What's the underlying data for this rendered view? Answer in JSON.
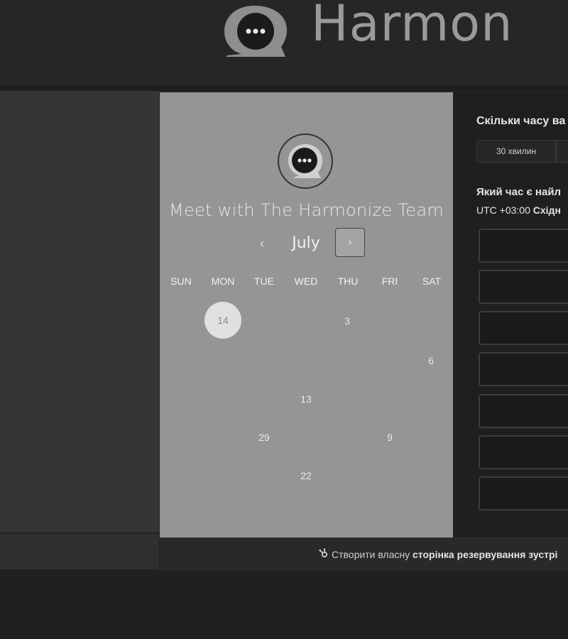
{
  "header": {
    "brand_text": "Harmon",
    "logo_icon": "chat-bubble-logo-icon"
  },
  "calendar": {
    "title": "Meet with The Harmonize Team",
    "month": "July",
    "prev_label": "‹",
    "next_label": "›",
    "weekdays": [
      "SUN",
      "MON",
      "TUE",
      "WED",
      "THU",
      "FRI",
      "SAT"
    ],
    "selected_day": "14",
    "days": [
      "3",
      "6",
      "13",
      "29",
      "9",
      "22"
    ]
  },
  "duration": {
    "question": "Скільки часу ва",
    "option_30": "30 хвилин"
  },
  "time": {
    "question": "Який час є найл",
    "timezone_prefix": "UTC +03:00",
    "timezone_name": "Східн"
  },
  "footer": {
    "text_prefix": "Створити власну",
    "text_strong": "сторінка резервування зустрі"
  },
  "colors": {
    "page_bg": "#232323",
    "calendar_bg": "#959595",
    "right_panel_bg": "#1f1f1f",
    "selected_day_bg": "#e0e0e0"
  }
}
